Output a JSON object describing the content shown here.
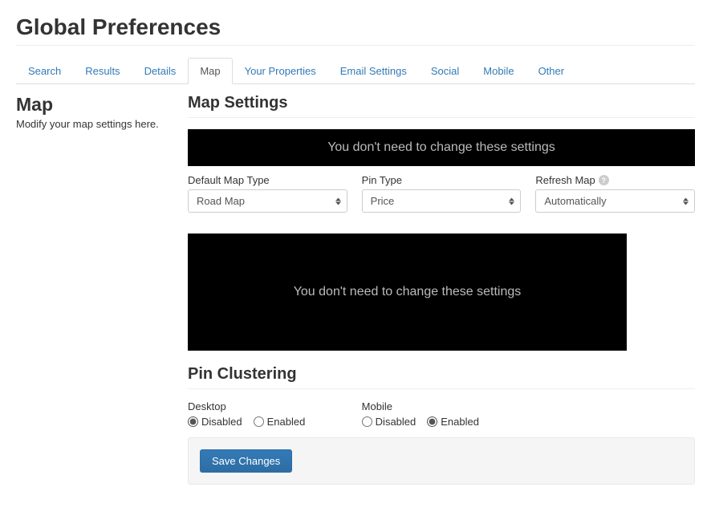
{
  "page_title": "Global Preferences",
  "tabs": [
    {
      "label": "Search"
    },
    {
      "label": "Results"
    },
    {
      "label": "Details"
    },
    {
      "label": "Map",
      "active": true
    },
    {
      "label": "Your Properties"
    },
    {
      "label": "Email Settings"
    },
    {
      "label": "Social"
    },
    {
      "label": "Mobile"
    },
    {
      "label": "Other"
    }
  ],
  "sidebar": {
    "title": "Map",
    "subtitle": "Modify your map settings here."
  },
  "map_settings": {
    "title": "Map Settings",
    "banner_text": "You don't need to change these settings",
    "default_map_type": {
      "label": "Default Map Type",
      "value": "Road Map"
    },
    "pin_type": {
      "label": "Pin Type",
      "value": "Price"
    },
    "refresh_map": {
      "label": "Refresh Map",
      "value": "Automatically"
    },
    "banner_text_2": "You don't need to change these settings"
  },
  "pin_clustering": {
    "title": "Pin Clustering",
    "desktop": {
      "label": "Desktop",
      "options": {
        "disabled": "Disabled",
        "enabled": "Enabled"
      },
      "selected": "disabled"
    },
    "mobile": {
      "label": "Mobile",
      "options": {
        "disabled": "Disabled",
        "enabled": "Enabled"
      },
      "selected": "enabled"
    }
  },
  "save_button": "Save Changes"
}
